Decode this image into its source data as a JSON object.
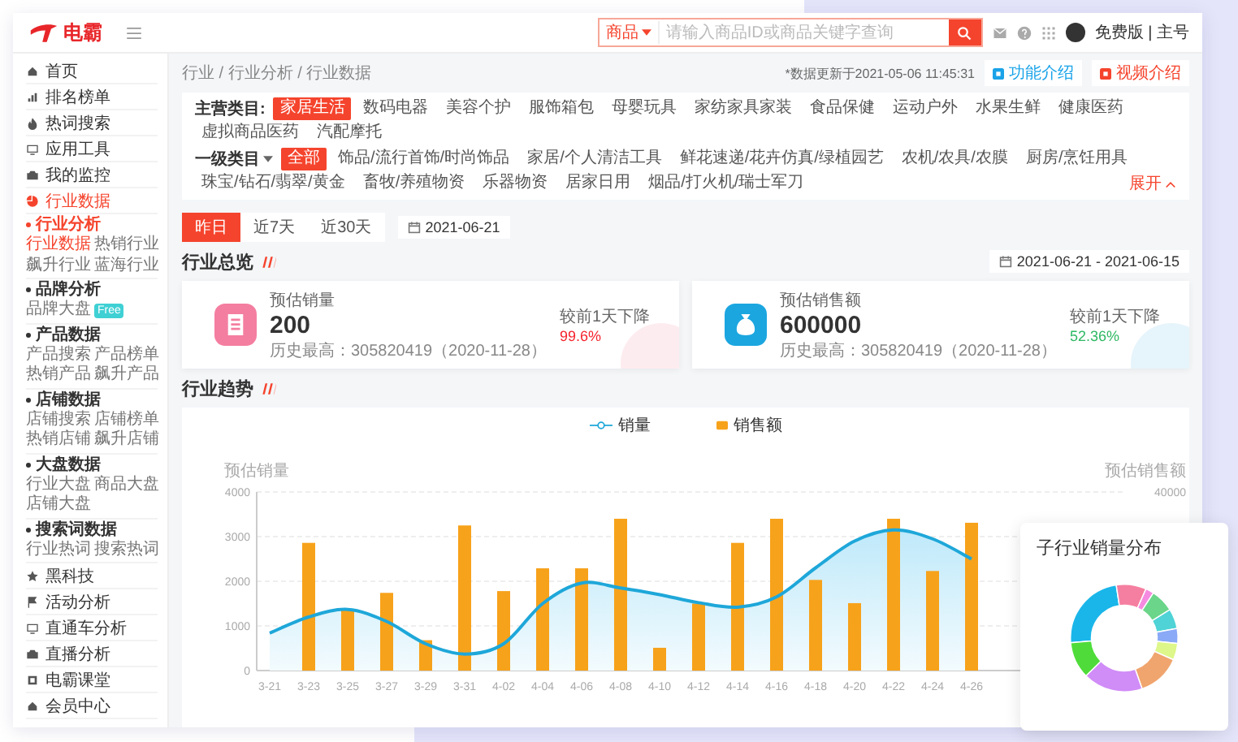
{
  "header": {
    "logo": "电霸",
    "search": {
      "scope": "商品",
      "placeholder": "请输入商品ID或商品关键字查询"
    },
    "account": "免费版 | 主号"
  },
  "sidebar": {
    "top": [
      {
        "label": "首页",
        "selected": false
      },
      {
        "label": "排名榜单",
        "selected": false
      },
      {
        "label": "热词搜索",
        "selected": false
      },
      {
        "label": "应用工具",
        "selected": false
      },
      {
        "label": "我的监控",
        "selected": false
      },
      {
        "label": "行业数据",
        "selected": true
      }
    ],
    "sections": [
      {
        "title": "行业分析",
        "selected": true,
        "links": [
          {
            "label": "行业数据",
            "selected": true
          },
          {
            "label": "热销行业",
            "selected": false
          },
          {
            "label": "飙升行业",
            "selected": false
          },
          {
            "label": "蓝海行业",
            "selected": false
          }
        ]
      },
      {
        "title": "品牌分析",
        "selected": false,
        "links": [
          {
            "label": "品牌大盘",
            "selected": false,
            "badge": "Free"
          }
        ]
      },
      {
        "title": "产品数据",
        "selected": false,
        "links": [
          {
            "label": "产品搜索",
            "selected": false
          },
          {
            "label": "产品榜单",
            "selected": false
          },
          {
            "label": "热销产品",
            "selected": false
          },
          {
            "label": "飙升产品",
            "selected": false
          }
        ]
      },
      {
        "title": "店铺数据",
        "selected": false,
        "links": [
          {
            "label": "店铺搜索",
            "selected": false
          },
          {
            "label": "店铺榜单",
            "selected": false
          },
          {
            "label": "热销店铺",
            "selected": false
          },
          {
            "label": "飙升店铺",
            "selected": false
          }
        ]
      },
      {
        "title": "大盘数据",
        "selected": false,
        "links": [
          {
            "label": "行业大盘",
            "selected": false
          },
          {
            "label": "商品大盘",
            "selected": false
          },
          {
            "label": "店铺大盘",
            "selected": false
          }
        ]
      },
      {
        "title": "搜索词数据",
        "selected": false,
        "links": [
          {
            "label": "行业热词",
            "selected": false
          },
          {
            "label": "搜索热词",
            "selected": false
          }
        ]
      }
    ],
    "bottom": [
      {
        "label": "黑科技",
        "selected": false
      },
      {
        "label": "活动分析",
        "selected": false
      },
      {
        "label": "直通车分析",
        "selected": false
      },
      {
        "label": "直播分析",
        "selected": false
      },
      {
        "label": "电霸课堂",
        "selected": false
      },
      {
        "label": "会员中心",
        "selected": false
      }
    ]
  },
  "breadcrumb": "行业 / 行业分析 / 行业数据",
  "update_note": "*数据更新于2021-05-06 11:45:31",
  "help_buttons": [
    {
      "label": "功能介绍",
      "kind": "info"
    },
    {
      "label": "视频介绍",
      "kind": "video"
    }
  ],
  "filters": [
    {
      "label": "主营类目:",
      "dropdown": false,
      "options": [
        {
          "label": "家居生活",
          "selected": true
        },
        {
          "label": "数码电器",
          "selected": false
        },
        {
          "label": "美容个护",
          "selected": false
        },
        {
          "label": "服饰箱包",
          "selected": false
        },
        {
          "label": "母婴玩具",
          "selected": false
        },
        {
          "label": "家纺家具家装",
          "selected": false
        },
        {
          "label": "食品保健",
          "selected": false
        },
        {
          "label": "运动户外",
          "selected": false
        },
        {
          "label": "水果生鲜",
          "selected": false
        },
        {
          "label": "健康医药",
          "selected": false
        },
        {
          "label": "虚拟商品医药",
          "selected": false
        },
        {
          "label": "汽配摩托",
          "selected": false
        }
      ]
    },
    {
      "label": "一级类目",
      "dropdown": true,
      "options": [
        {
          "label": "全部",
          "selected": true
        },
        {
          "label": "饰品/流行首饰/时尚饰品",
          "selected": false
        },
        {
          "label": "家居/个人清洁工具",
          "selected": false
        },
        {
          "label": "鲜花速递/花卉仿真/绿植园艺",
          "selected": false
        },
        {
          "label": "农机/农具/农膜",
          "selected": false
        },
        {
          "label": "厨房/烹饪用具",
          "selected": false
        },
        {
          "label": "珠宝/钻石/翡翠/黄金",
          "selected": false
        },
        {
          "label": "畜牧/养殖物资",
          "selected": false
        },
        {
          "label": "乐器物资",
          "selected": false
        },
        {
          "label": "居家日用",
          "selected": false
        },
        {
          "label": "烟品/打火机/瑞士军刀",
          "selected": false
        }
      ]
    }
  ],
  "expand_link": "展开",
  "period_tabs": [
    {
      "label": "昨日",
      "selected": true
    },
    {
      "label": "近7天",
      "selected": false
    },
    {
      "label": "近30天",
      "selected": false
    }
  ],
  "date": "2021-06-21",
  "overview": {
    "title": "行业总览",
    "range": "2021-06-21 - 2021-06-15",
    "cards": [
      {
        "kind": "volume",
        "label": "预估销量",
        "value": "200",
        "record": "历史最高：305820419（2020-11-28）",
        "change_label": "较前1天下降",
        "change": "99.6%",
        "color": "#f5222d"
      },
      {
        "kind": "revenue",
        "label": "预估销售额",
        "value": "600000",
        "record": "历史最高：305820419（2020-11-28）",
        "change_label": "较前1天下降",
        "change": "52.36%",
        "color": "#2fb864"
      }
    ]
  },
  "trend": {
    "title": "行业趋势",
    "right_axis": {
      "title": "预估销售额",
      "tick": "40000"
    },
    "chart_data": {
      "type": "bar",
      "ylabel": "预估销量",
      "grid": true,
      "categories": [
        "3-21",
        "3-23",
        "3-25",
        "3-27",
        "3-29",
        "3-31",
        "4-02",
        "4-04",
        "4-06",
        "4-08",
        "4-10",
        "4-12",
        "4-14",
        "4-16",
        "4-18",
        "4-20",
        "4-22",
        "4-24",
        "4-26"
      ],
      "series": [
        {
          "name": "销量",
          "type": "area",
          "color": "#1ea7d9",
          "values": [
            840,
            1200,
            1370,
            1100,
            600,
            370,
            600,
            1500,
            1960,
            1850,
            1700,
            1520,
            1420,
            1650,
            2300,
            2900,
            3150,
            2950,
            2500
          ]
        },
        {
          "name": "销售额",
          "color": "#f7a21b",
          "values": [
            null,
            2860,
            1350,
            1740,
            680,
            3250,
            1780,
            2290,
            2290,
            3400,
            510,
            1500,
            2860,
            3400,
            2030,
            1510,
            3400,
            2230,
            3310
          ]
        }
      ],
      "ylim": [
        0,
        4000
      ],
      "yticks": [
        0,
        1000,
        2000,
        3000,
        4000
      ]
    }
  },
  "distribution": {
    "title": "子行业销量分布"
  }
}
